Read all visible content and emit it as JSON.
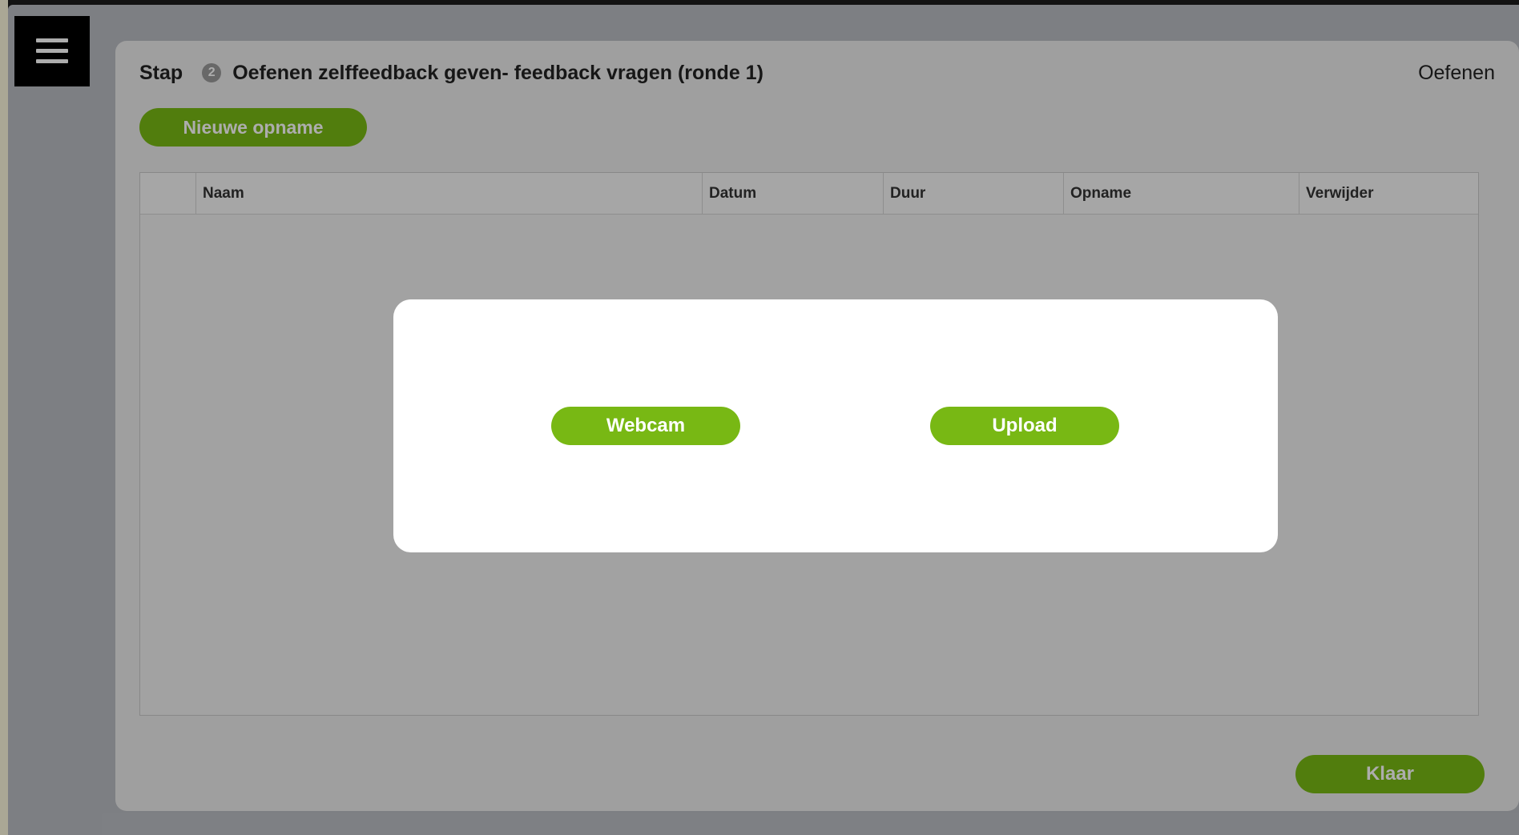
{
  "header": {
    "menu_icon": "hamburger-menu-icon",
    "step_label": "Stap",
    "step_number": "2",
    "step_title": "Oefenen zelffeedback geven- feedback vragen (ronde 1)",
    "section_label": "Oefenen"
  },
  "actions": {
    "new_recording_label": "Nieuwe opname",
    "done_label": "Klaar"
  },
  "table": {
    "columns": [
      "",
      "Naam",
      "Datum",
      "Duur",
      "Opname",
      "Verwijder"
    ],
    "rows": []
  },
  "modal": {
    "webcam_label": "Webcam",
    "upload_label": "Upload"
  },
  "colors": {
    "accent_green": "#78b814",
    "overlay": "rgba(0,0,0,0.32)"
  }
}
